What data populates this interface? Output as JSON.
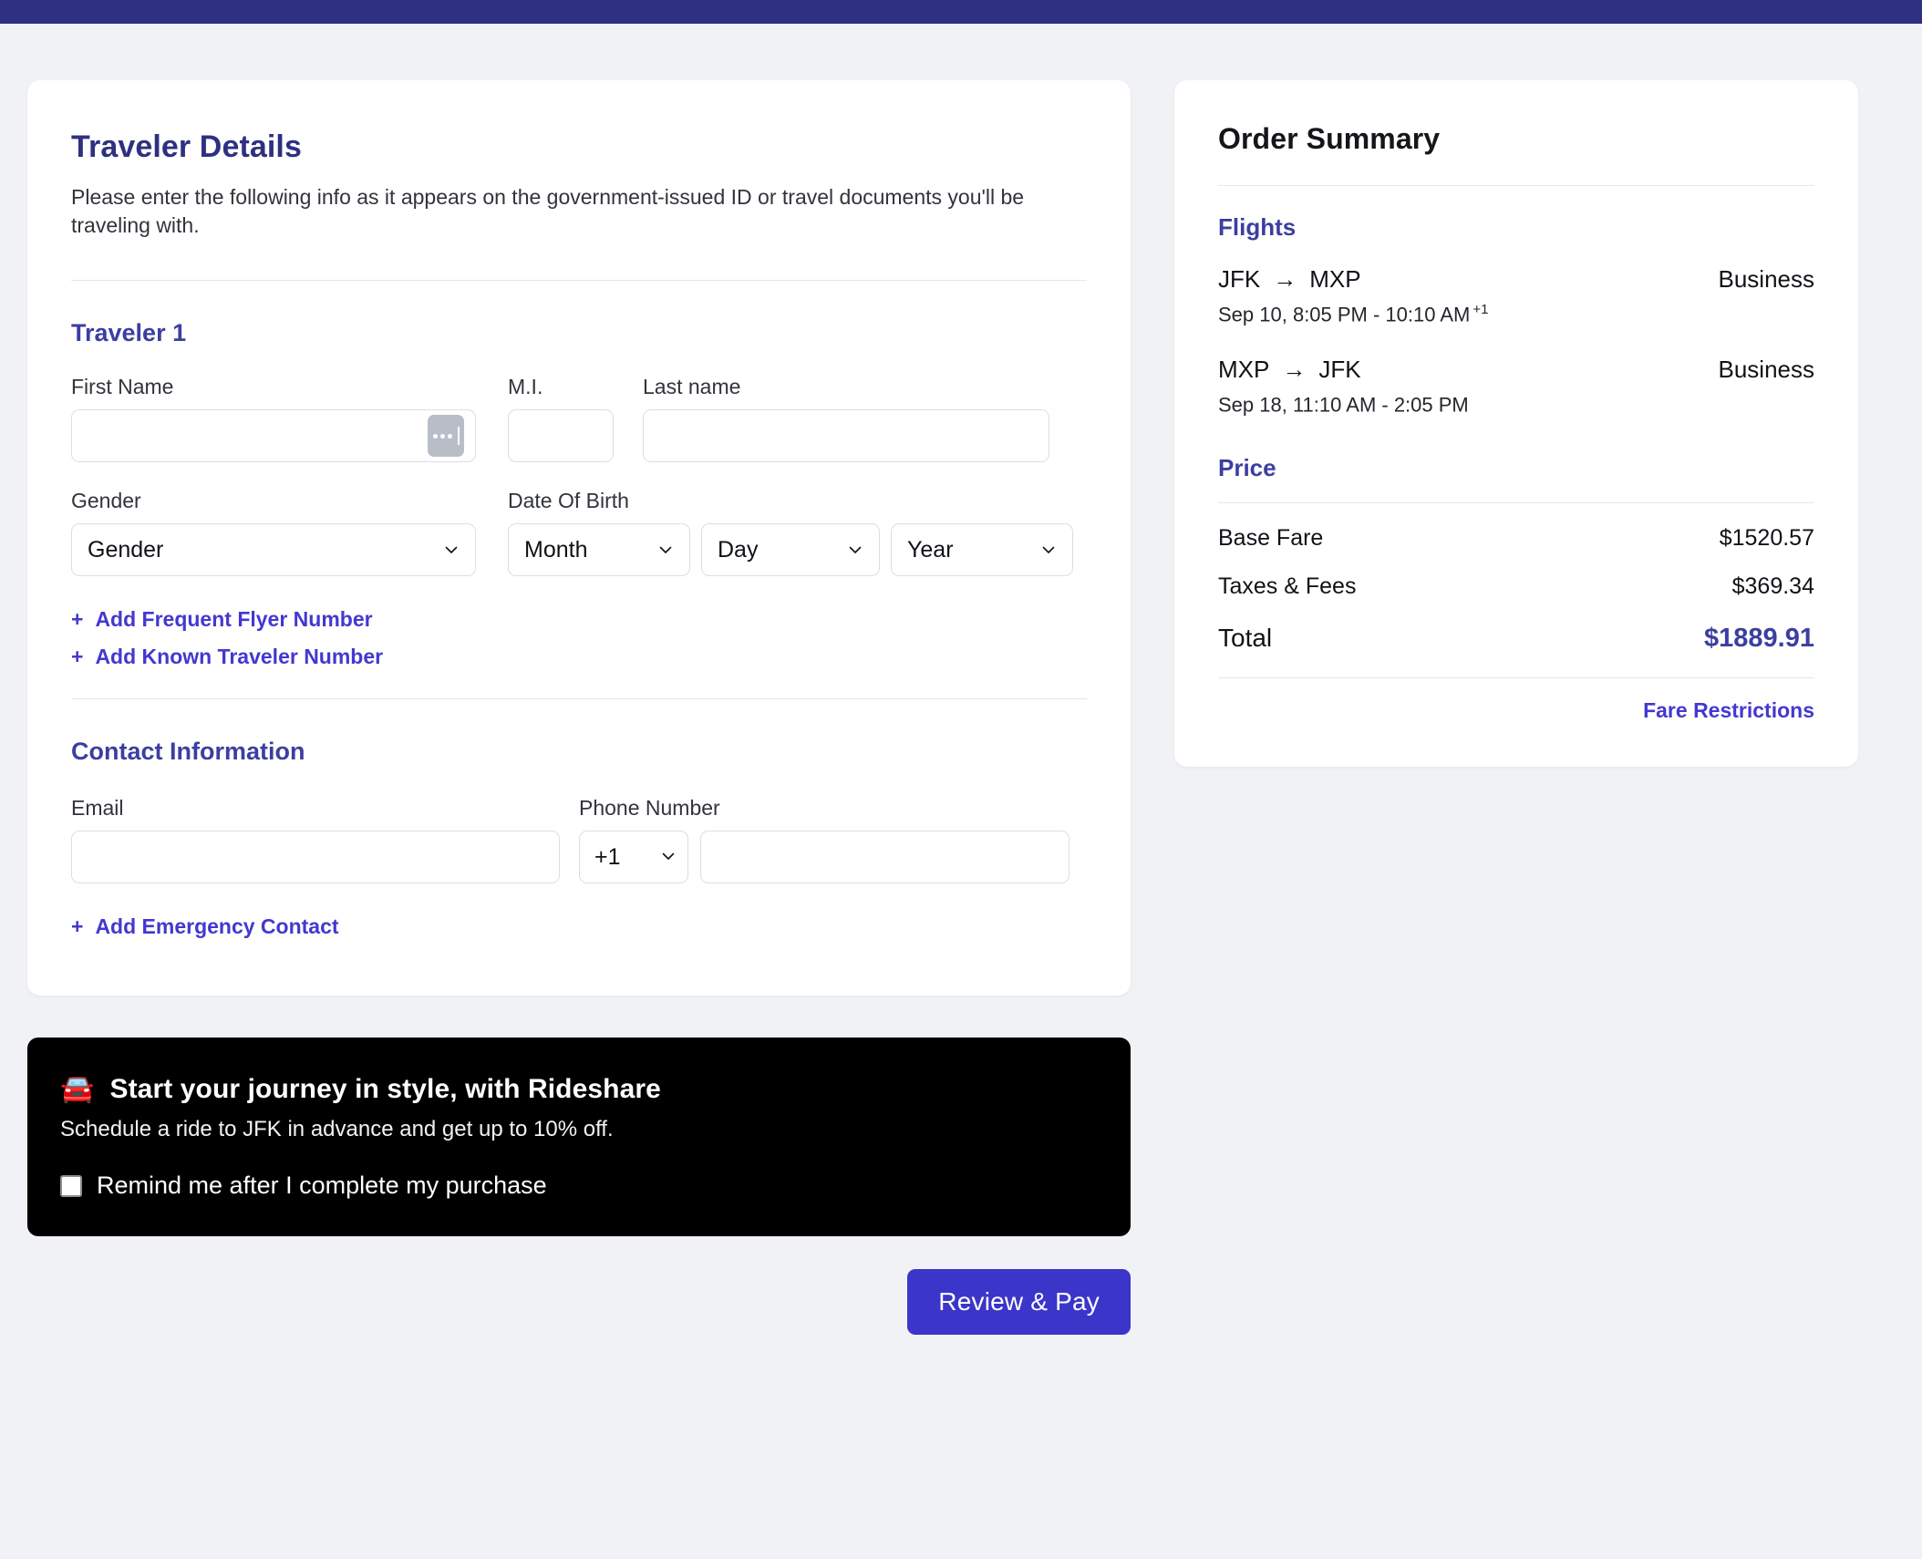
{
  "theme": {
    "topbar_color": "#2e3180",
    "page_bg": "#f1f2f5",
    "accent": "#3b35c9",
    "heading_color": "#2e3180",
    "link_color": "#4338d0",
    "promo_bg": "#000000"
  },
  "traveler_details": {
    "title": "Traveler Details",
    "intro": "Please enter the following info as it appears on the government-issued ID or travel documents you'll be traveling with.",
    "traveler_label": "Traveler 1",
    "fields": {
      "first_name_label": "First Name",
      "first_name_value": "",
      "first_name_placeholder": "",
      "mi_label": "M.I.",
      "mi_value": "",
      "last_name_label": "Last name",
      "last_name_value": "",
      "gender_label": "Gender",
      "gender_value": "Gender",
      "dob_label": "Date Of Birth",
      "dob_month_value": "Month",
      "dob_day_value": "Day",
      "dob_year_value": "Year"
    },
    "autofill_icon": "ellipsis-autofill-icon",
    "links": [
      {
        "plus": "+",
        "label": "Add Frequent Flyer Number"
      },
      {
        "plus": "+",
        "label": "Add Known Traveler Number"
      }
    ]
  },
  "contact_information": {
    "title": "Contact Information",
    "email_label": "Email",
    "email_value": "",
    "phone_label": "Phone Number",
    "country_code_value": "+1",
    "phone_value": "",
    "add_emergency": {
      "plus": "+",
      "label": "Add Emergency Contact"
    }
  },
  "promo": {
    "emoji": "🚘",
    "title": "Start your journey in style, with Rideshare",
    "subtitle": "Schedule a ride to JFK in advance and get up to 10% off.",
    "checkbox_label": "Remind me after I complete my purchase",
    "checkbox_checked": false
  },
  "actions": {
    "primary_label": "Review & Pay"
  },
  "order_summary": {
    "title": "Order Summary",
    "flights_heading": "Flights",
    "flights": [
      {
        "origin": "JFK",
        "arrow": "→",
        "destination": "MXP",
        "cabin": "Business",
        "when": "Sep 10, 8:05 PM - 10:10 AM",
        "day_offset": "+1"
      },
      {
        "origin": "MXP",
        "arrow": "→",
        "destination": "JFK",
        "cabin": "Business",
        "when": "Sep 18, 11:10 AM - 2:05 PM",
        "day_offset": ""
      }
    ],
    "price_heading": "Price",
    "price_rows": [
      {
        "label": "Base Fare",
        "value": "$1520.57"
      },
      {
        "label": "Taxes & Fees",
        "value": "$369.34"
      }
    ],
    "total_label": "Total",
    "total_value": "$1889.91",
    "fare_restrictions_label": "Fare Restrictions"
  }
}
